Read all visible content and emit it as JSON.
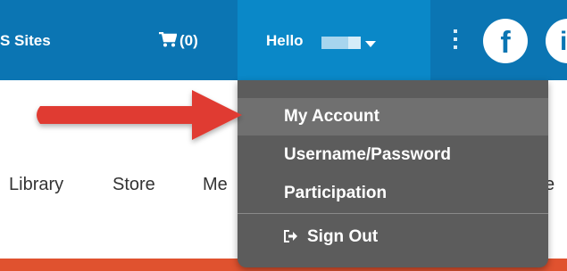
{
  "header": {
    "sites_label": "S Sites",
    "cart": {
      "icon": "cart-icon",
      "count_label": "(0)"
    },
    "greeting": "Hello",
    "menu_icon": "kebab-menu-icon",
    "social": [
      {
        "icon": "facebook-icon",
        "glyph": "f"
      },
      {
        "icon": "linkedin-icon",
        "glyph": "in"
      }
    ],
    "colors": {
      "bar": "#0b75b3",
      "active_tab": "#0a88c8"
    }
  },
  "nav": {
    "items": [
      "Library",
      "Store",
      "Me",
      "ve"
    ]
  },
  "account_menu": {
    "items": [
      {
        "label": "My Account",
        "highlighted": true
      },
      {
        "label": "Username/Password",
        "highlighted": false
      },
      {
        "label": "Participation",
        "highlighted": false
      }
    ],
    "sign_out": {
      "label": "Sign Out",
      "icon": "sign-out-icon"
    },
    "colors": {
      "background": "#5c5c5c",
      "highlight": "#707070"
    }
  },
  "annotation": {
    "arrow_color": "#e03a32"
  }
}
